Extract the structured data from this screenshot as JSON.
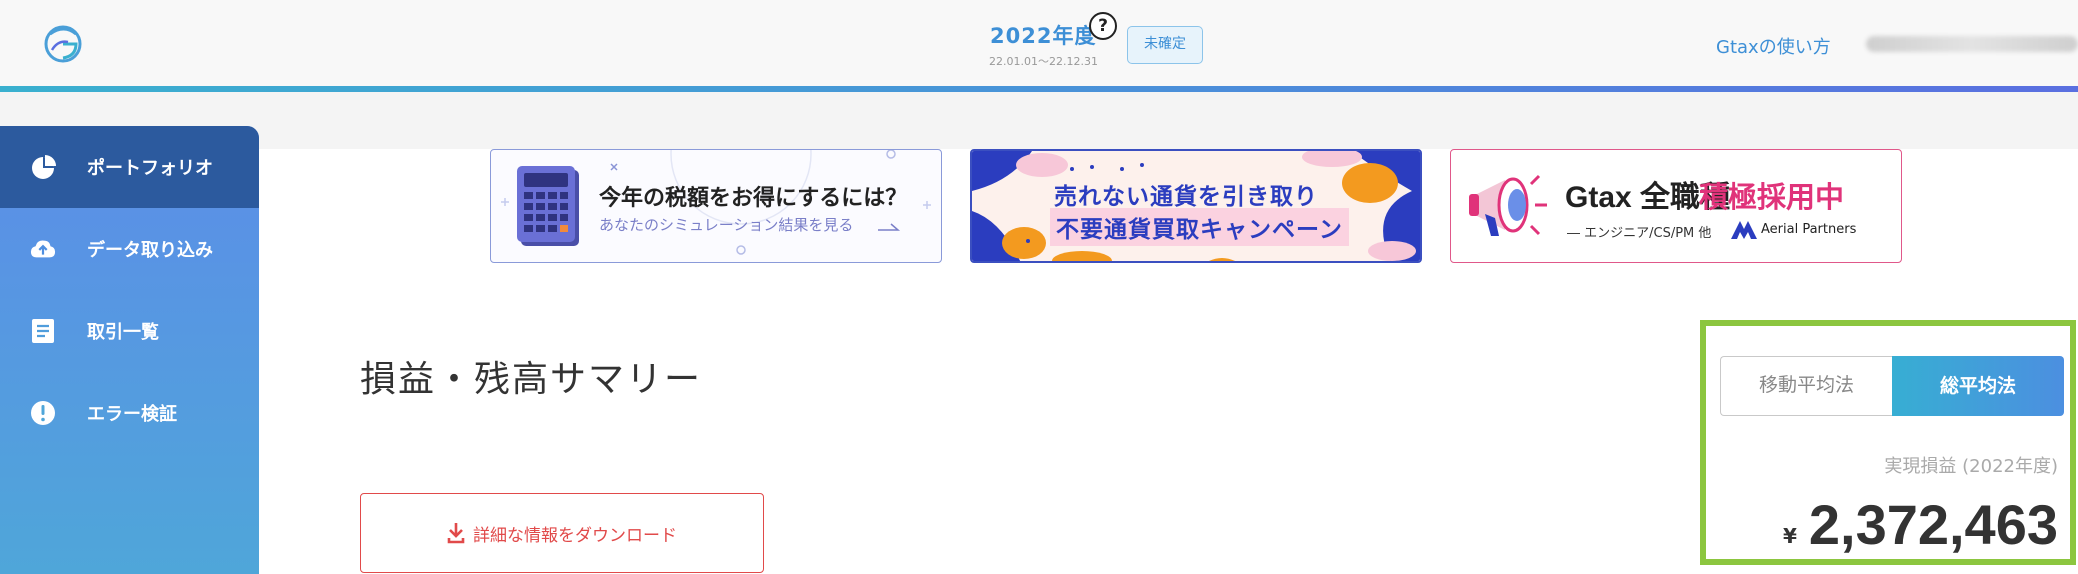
{
  "header": {
    "fiscal_year": "2022年度",
    "help_icon": "?",
    "period": "22.01.01〜22.12.31",
    "status_badge": "未確定",
    "howto_link": "Gtaxの使い方"
  },
  "sidebar": {
    "items": [
      {
        "label": "ポートフォリオ",
        "icon": "pie-chart-icon",
        "active": true
      },
      {
        "label": "データ取り込み",
        "icon": "cloud-upload-icon",
        "active": false
      },
      {
        "label": "取引一覧",
        "icon": "list-document-icon",
        "active": false
      },
      {
        "label": "エラー検証",
        "icon": "exclamation-icon",
        "active": false
      }
    ]
  },
  "banners": [
    {
      "title": "今年の税額をお得にするには？",
      "subtitle": "あなたのシミュレーション結果を見る"
    },
    {
      "line1": "売れない通貨を引き取り",
      "line2": "不要通貨買取キャンペーン"
    },
    {
      "brand": "Gtax 全職種",
      "highlight": "積極採用中",
      "roles": "― エンジニア/CS/PM 他",
      "partner": "Aerial Partners"
    }
  ],
  "main": {
    "page_title": "損益・残高サマリー",
    "download_button": "詳細な情報をダウンロード"
  },
  "summary": {
    "method_moving_average": "移動平均法",
    "method_total_average": "総平均法",
    "selected_method": "総平均法",
    "realized_label": "実現損益 (2022年度)",
    "currency_symbol": "¥",
    "realized_value": "2,372,463"
  },
  "colors": {
    "accent_blue": "#3d8fd6",
    "sidebar_active": "#2c5a9e",
    "danger_red": "#e14a4a",
    "highlight_green": "#8cc63f",
    "campaign_pink": "#e0337a"
  }
}
